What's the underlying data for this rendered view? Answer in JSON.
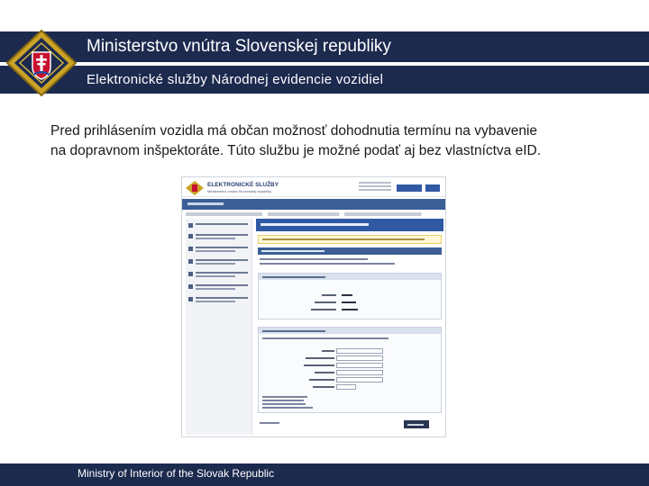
{
  "header": {
    "title": "Ministerstvo vnútra Slovenskej republiky",
    "subtitle": "Elektronické služby Národnej evidencie vozidiel",
    "logo_icon": "ministry-coat-of-arms-icon",
    "band_color": "#1c2a4e"
  },
  "content": {
    "intro_text": "Pred prihlásením vozidla má občan možnosť dohodnutia termínu na vybavenie na dopravnom inšpektoráte. Túto službu je možné podať aj bez vlastníctva eID."
  },
  "embedded_screenshot": {
    "brand_title": "ELEKTRONICKÉ SLUŽBY",
    "brand_subtitle": "Ministerstvo vnútra Slovenskej republiky",
    "accent_color": "#2f5aa3"
  },
  "footer": {
    "text": "Ministry of Interior of the Slovak Republic"
  }
}
